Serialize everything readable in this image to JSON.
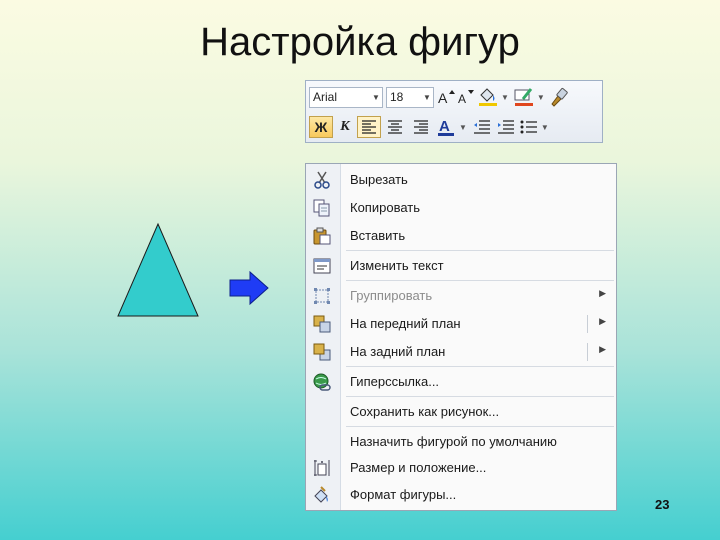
{
  "slide": {
    "title": "Настройка фигур",
    "page_number": "23"
  },
  "shapes": {
    "triangle_fill": "#33cccc",
    "arrow_fill": "#1f3cf5"
  },
  "mini_toolbar": {
    "font_name": "Arial",
    "font_size": "18",
    "icons": [
      "grow-font-icon",
      "shrink-font-icon",
      "fill-color-icon",
      "outline-color-icon",
      "format-painter-icon",
      "bold-icon",
      "italic-icon",
      "align-left-icon",
      "center-icon",
      "align-right-icon",
      "font-color-icon",
      "decrease-indent-icon",
      "increase-indent-icon",
      "bullets-icon"
    ],
    "bold_label": "Ж",
    "italic_label": "К",
    "font_color_label": "A"
  },
  "context_menu": {
    "items": [
      {
        "label": "Вырезать",
        "icon": "cut-icon"
      },
      {
        "label": "Копировать",
        "icon": "copy-icon"
      },
      {
        "label": "Вставить",
        "icon": "paste-icon"
      },
      {
        "label": "Изменить текст",
        "icon": "edit-text-icon"
      },
      {
        "label": "Группировать",
        "icon": "group-icon",
        "disabled": true
      },
      {
        "label": "На передний план",
        "icon": "bring-to-front-icon"
      },
      {
        "label": "На задний план",
        "icon": "send-to-back-icon"
      },
      {
        "label": "Гиперссылка...",
        "icon": "hyperlink-icon"
      },
      {
        "label": "Сохранить как рисунок..."
      },
      {
        "label": "Назначить фигурой по умолчанию"
      },
      {
        "label": "Размер и положение...",
        "icon": "size-position-icon"
      },
      {
        "label": "Формат фигуры...",
        "icon": "format-shape-icon"
      }
    ]
  }
}
